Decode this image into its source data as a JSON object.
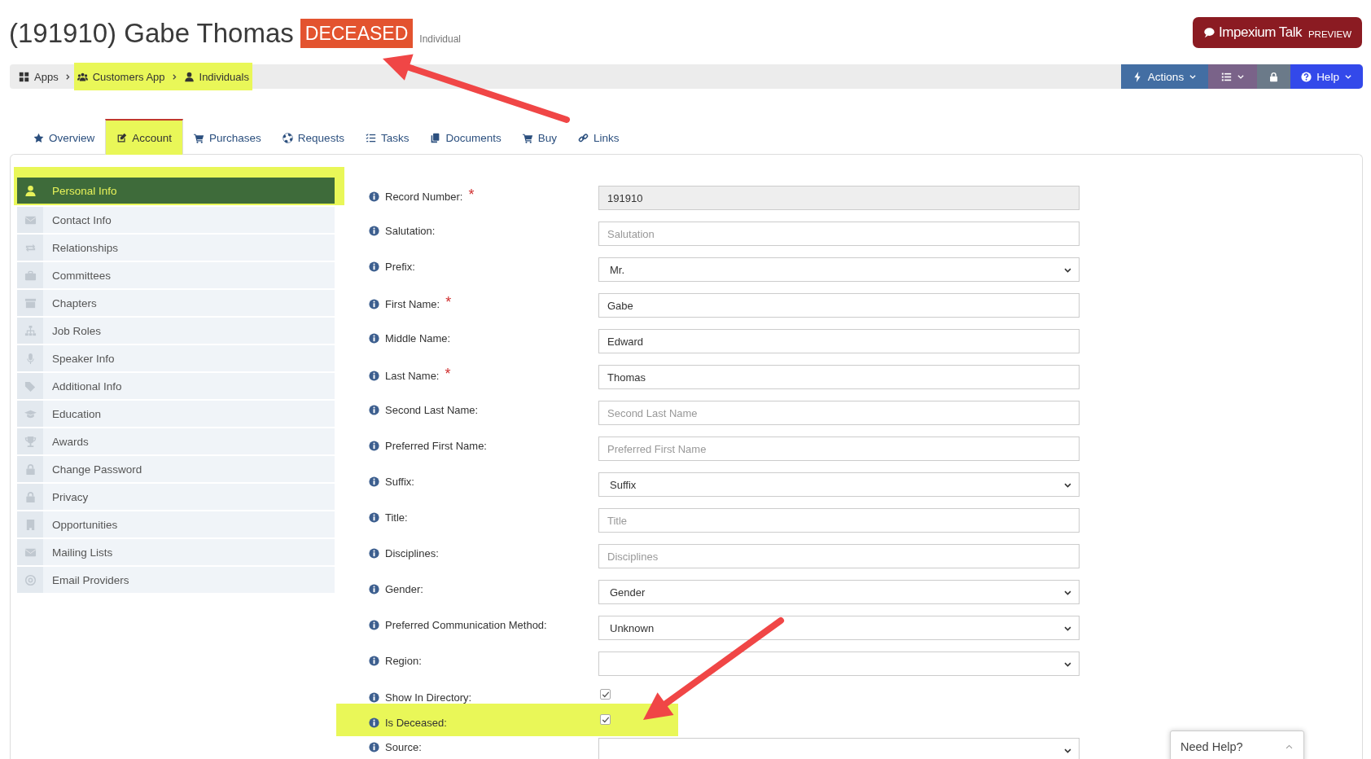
{
  "header": {
    "title": "(191910) Gabe Thomas",
    "status_badge": "DECEASED",
    "record_type": "Individual"
  },
  "talk_button": {
    "label": "Impexium Talk",
    "tag": "PREVIEW"
  },
  "breadcrumbs": [
    {
      "label": "Apps",
      "highlighted": false
    },
    {
      "label": "Customers App",
      "highlighted": true
    },
    {
      "label": "Individuals",
      "highlighted": true
    }
  ],
  "toolbar": [
    {
      "kind": "actions",
      "label": "Actions"
    },
    {
      "kind": "list"
    },
    {
      "kind": "lock"
    },
    {
      "kind": "help",
      "label": "Help"
    }
  ],
  "tabs": [
    {
      "label": "Overview",
      "selected": false,
      "highlighted": false
    },
    {
      "label": "Account",
      "selected": true,
      "highlighted": true
    },
    {
      "label": "Purchases",
      "selected": false,
      "highlighted": false
    },
    {
      "label": "Requests",
      "selected": false,
      "highlighted": false
    },
    {
      "label": "Tasks",
      "selected": false,
      "highlighted": false
    },
    {
      "label": "Documents",
      "selected": false,
      "highlighted": false
    },
    {
      "label": "Buy",
      "selected": false,
      "highlighted": false
    },
    {
      "label": "Links",
      "selected": false,
      "highlighted": false
    }
  ],
  "sidebar": {
    "items": [
      {
        "label": "Personal Info",
        "selected": true,
        "highlighted": true
      },
      {
        "label": "Contact Info",
        "selected": false,
        "highlighted": false
      },
      {
        "label": "Relationships",
        "selected": false,
        "highlighted": false
      },
      {
        "label": "Committees",
        "selected": false,
        "highlighted": false
      },
      {
        "label": "Chapters",
        "selected": false,
        "highlighted": false
      },
      {
        "label": "Job Roles",
        "selected": false,
        "highlighted": false
      },
      {
        "label": "Speaker Info",
        "selected": false,
        "highlighted": false
      },
      {
        "label": "Additional Info",
        "selected": false,
        "highlighted": false
      },
      {
        "label": "Education",
        "selected": false,
        "highlighted": false
      },
      {
        "label": "Awards",
        "selected": false,
        "highlighted": false
      },
      {
        "label": "Change Password",
        "selected": false,
        "highlighted": false
      },
      {
        "label": "Privacy",
        "selected": false,
        "highlighted": false
      },
      {
        "label": "Opportunities",
        "selected": false,
        "highlighted": false
      },
      {
        "label": "Mailing Lists",
        "selected": false,
        "highlighted": false
      },
      {
        "label": "Email Providers",
        "selected": false,
        "highlighted": false
      }
    ]
  },
  "form": {
    "required_mark": "*",
    "fields": [
      {
        "label": "Record Number:",
        "kind": "text",
        "required": true,
        "readonly": true,
        "value": "191910",
        "highlighted": false
      },
      {
        "label": "Salutation:",
        "kind": "text",
        "required": false,
        "readonly": false,
        "placeholder": "Salutation",
        "highlighted": false
      },
      {
        "label": "Prefix:",
        "kind": "select",
        "required": false,
        "value": "Mr.",
        "highlighted": false
      },
      {
        "label": "First Name:",
        "kind": "text",
        "required": true,
        "readonly": false,
        "value": "Gabe",
        "highlighted": false
      },
      {
        "label": "Middle Name:",
        "kind": "text",
        "required": false,
        "readonly": false,
        "value": "Edward",
        "highlighted": false
      },
      {
        "label": "Last Name:",
        "kind": "text",
        "required": true,
        "readonly": false,
        "value": "Thomas",
        "highlighted": false
      },
      {
        "label": "Second Last Name:",
        "kind": "text",
        "required": false,
        "readonly": false,
        "placeholder": "Second Last Name",
        "highlighted": false
      },
      {
        "label": "Preferred First Name:",
        "kind": "text",
        "required": false,
        "readonly": false,
        "placeholder": "Preferred First Name",
        "highlighted": false
      },
      {
        "label": "Suffix:",
        "kind": "select",
        "required": false,
        "value": "Suffix",
        "highlighted": false
      },
      {
        "label": "Title:",
        "kind": "text",
        "required": false,
        "readonly": false,
        "placeholder": "Title",
        "highlighted": false
      },
      {
        "label": "Disciplines:",
        "kind": "text",
        "required": false,
        "readonly": false,
        "placeholder": "Disciplines",
        "highlighted": false
      },
      {
        "label": "Gender:",
        "kind": "select",
        "required": false,
        "value": "Gender",
        "highlighted": false
      },
      {
        "label": "Preferred Communication Method:",
        "kind": "select",
        "required": false,
        "value": "Unknown",
        "highlighted": false
      },
      {
        "label": "Region:",
        "kind": "select",
        "required": false,
        "highlighted": false
      },
      {
        "label": "Show In Directory:",
        "kind": "checkbox",
        "required": false,
        "checked": true,
        "highlighted": false
      },
      {
        "label": "Is Deceased:",
        "kind": "checkbox",
        "required": false,
        "checked": true,
        "highlighted": true
      },
      {
        "label": "Source:",
        "kind": "select",
        "required": false,
        "highlighted": false
      }
    ]
  },
  "need_help": {
    "label": "Need Help?"
  }
}
